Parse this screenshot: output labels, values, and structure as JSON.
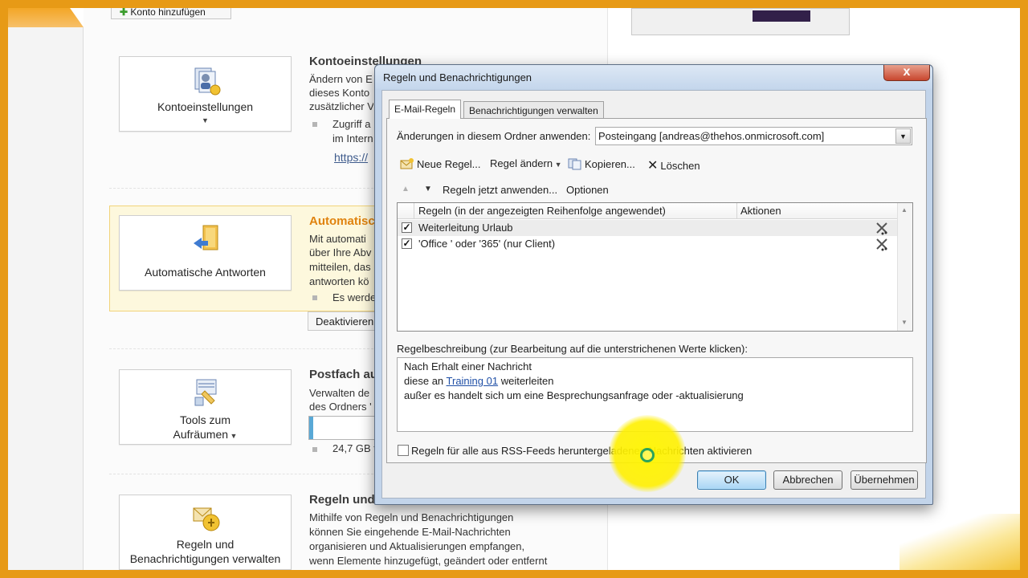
{
  "backstage": {
    "add_account_label": "Konto hinzufügen",
    "sections": {
      "account_settings": {
        "card_label": "Kontoeinstellungen",
        "title": "Kontoeinstellungen",
        "text_lines": [
          "Ändern von E",
          "dieses Konto",
          "zusätzlicher V"
        ],
        "bullet_lines": [
          "Zugriff a",
          "im Intern"
        ],
        "link": "https://"
      },
      "auto_replies": {
        "card_label": "Automatische Antworten",
        "title": "Automatisc",
        "text_lines": [
          "Mit automati",
          "über Ihre Abv",
          "mitteilen, das",
          "antworten kö"
        ],
        "bullet": "Es werde",
        "button_label": "Deaktivieren"
      },
      "cleanup": {
        "card_label_line1": "Tools zum",
        "card_label_line2": "Aufräumen",
        "title": "Postfach au",
        "text_lines": [
          "Verwalten de",
          "des Ordners '"
        ],
        "quota_fraction": 0.06,
        "bullet": "24,7 GB f"
      },
      "rules": {
        "card_label_line1": "Regeln und",
        "card_label_line2": "Benachrichtigungen verwalten",
        "title": "Regeln und",
        "text_lines": [
          "Mithilfe von Regeln und Benachrichtigungen",
          "können Sie eingehende E-Mail-Nachrichten",
          "organisieren und Aktualisierungen empfangen,",
          "wenn Elemente hinzugefügt, geändert oder entfernt"
        ]
      }
    }
  },
  "dialog": {
    "title": "Regeln und Benachrichtigungen",
    "close_label": "x",
    "tabs": [
      "E-Mail-Regeln",
      "Benachrichtigungen verwalten"
    ],
    "folder_label": "Änderungen in diesem Ordner anwenden:",
    "folder_value": "Posteingang [andreas@thehos.onmicrosoft.com]",
    "toolbar": {
      "new_rule": "Neue Regel...",
      "change_rule": "Regel ändern",
      "copy": "Kopieren...",
      "delete": "Löschen",
      "run_rules": "Regeln jetzt anwenden...",
      "options": "Optionen"
    },
    "list": {
      "col_rules": "Regeln (in der angezeigten Reihenfolge angewendet)",
      "col_actions": "Aktionen",
      "rows": [
        {
          "name": "Weiterleitung Urlaub",
          "checked": true
        },
        {
          "name": "'Office ' oder '365'  (nur Client)",
          "checked": true
        }
      ]
    },
    "description_label": "Regelbeschreibung (zur Bearbeitung auf die unterstrichenen Werte klicken):",
    "description": {
      "line1": "Nach Erhalt einer Nachricht",
      "line2_prefix": "diese an ",
      "line2_link": "Training 01",
      "line2_suffix": " weiterleiten",
      "line3": "außer es handelt sich um eine Besprechungsanfrage oder -aktualisierung"
    },
    "rss_label": "Regeln für alle aus RSS-Feeds heruntergeladenen Nachrichten aktivieren",
    "buttons": {
      "ok": "OK",
      "cancel": "Abbrechen",
      "apply": "Übernehmen"
    }
  }
}
